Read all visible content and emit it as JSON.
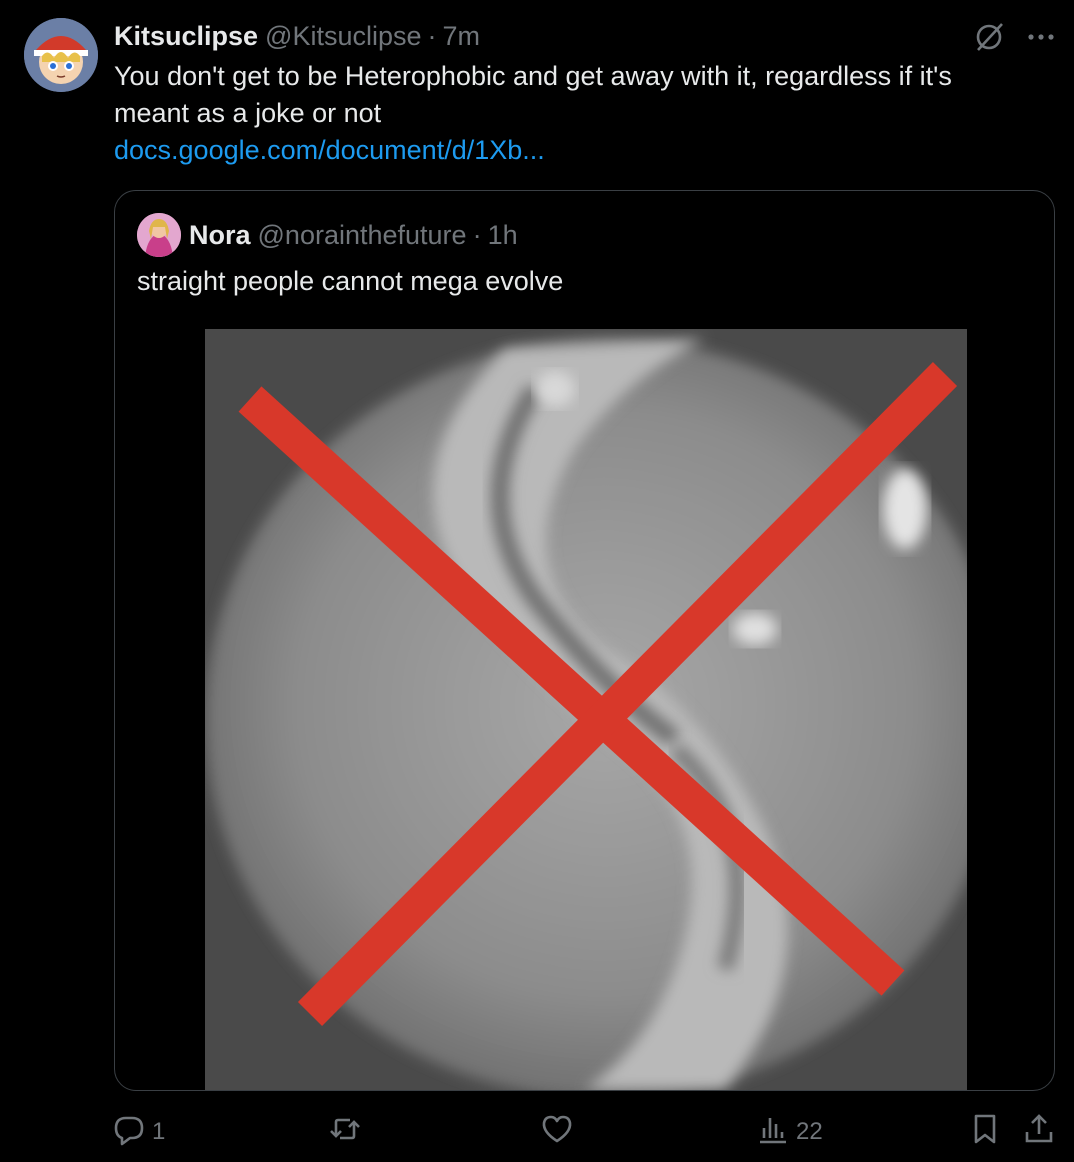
{
  "post": {
    "display_name": "Kitsuclipse",
    "handle": "@Kitsuclipse",
    "separator": "·",
    "time": "7m",
    "text": "You don't get to be Heterophobic and get away with it, regardless if it's meant as a joke or not",
    "link": "docs.google.com/document/d/1Xb...",
    "avatar_icon": "cartoon-fox-avatar",
    "grok_icon": "grok-icon",
    "more_icon": "more-dots-icon"
  },
  "quote": {
    "display_name": "Nora",
    "handle": "@norainthefuture",
    "separator": "·",
    "time": "1h",
    "text": "straight people cannot mega evolve",
    "image_description_icon": "crossed-out-mega-stone-image"
  },
  "actions": {
    "reply_count": "1",
    "retweet_count": "",
    "like_count": "",
    "views_count": "22",
    "icons": [
      "reply-icon",
      "retweet-icon",
      "like-icon",
      "views-icon",
      "bookmark-icon",
      "share-icon"
    ]
  },
  "colors": {
    "background": "#000000",
    "text": "#e7e9ea",
    "muted": "#71767b",
    "link": "#1d9bf0",
    "cross": "#d8382a"
  }
}
